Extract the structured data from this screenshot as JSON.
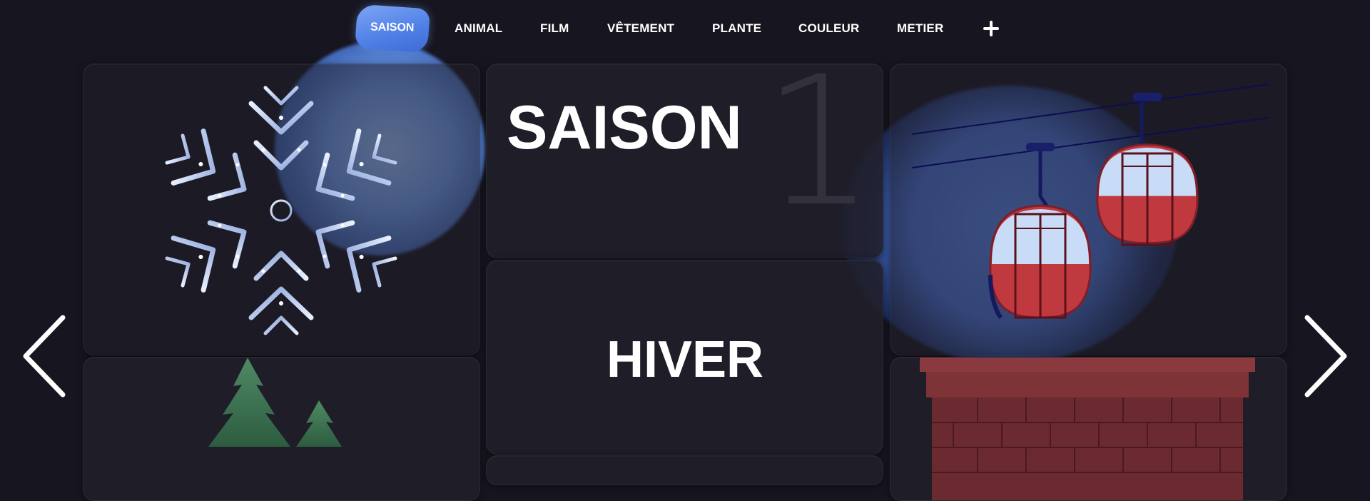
{
  "nav": {
    "items": [
      "SAISON",
      "ANIMAL",
      "FILM",
      "VÊTEMENT",
      "PLANTE",
      "COULEUR",
      "METIER"
    ],
    "active_index": 0,
    "add_icon": "plus-icon"
  },
  "main": {
    "category_title": "SAISON",
    "category_number": "1",
    "answer": "HIVER"
  },
  "cards": {
    "images": [
      "snowflake",
      "cable-car-gondolas",
      "fir-trees",
      "brick-chimney"
    ]
  },
  "controls": {
    "prev_icon": "chevron-left-icon",
    "next_icon": "chevron-right-icon"
  },
  "colors": {
    "background": "#17151f",
    "accent": "#5b8af0",
    "card": "#201f2a",
    "gondola_red": "#c0393f"
  }
}
